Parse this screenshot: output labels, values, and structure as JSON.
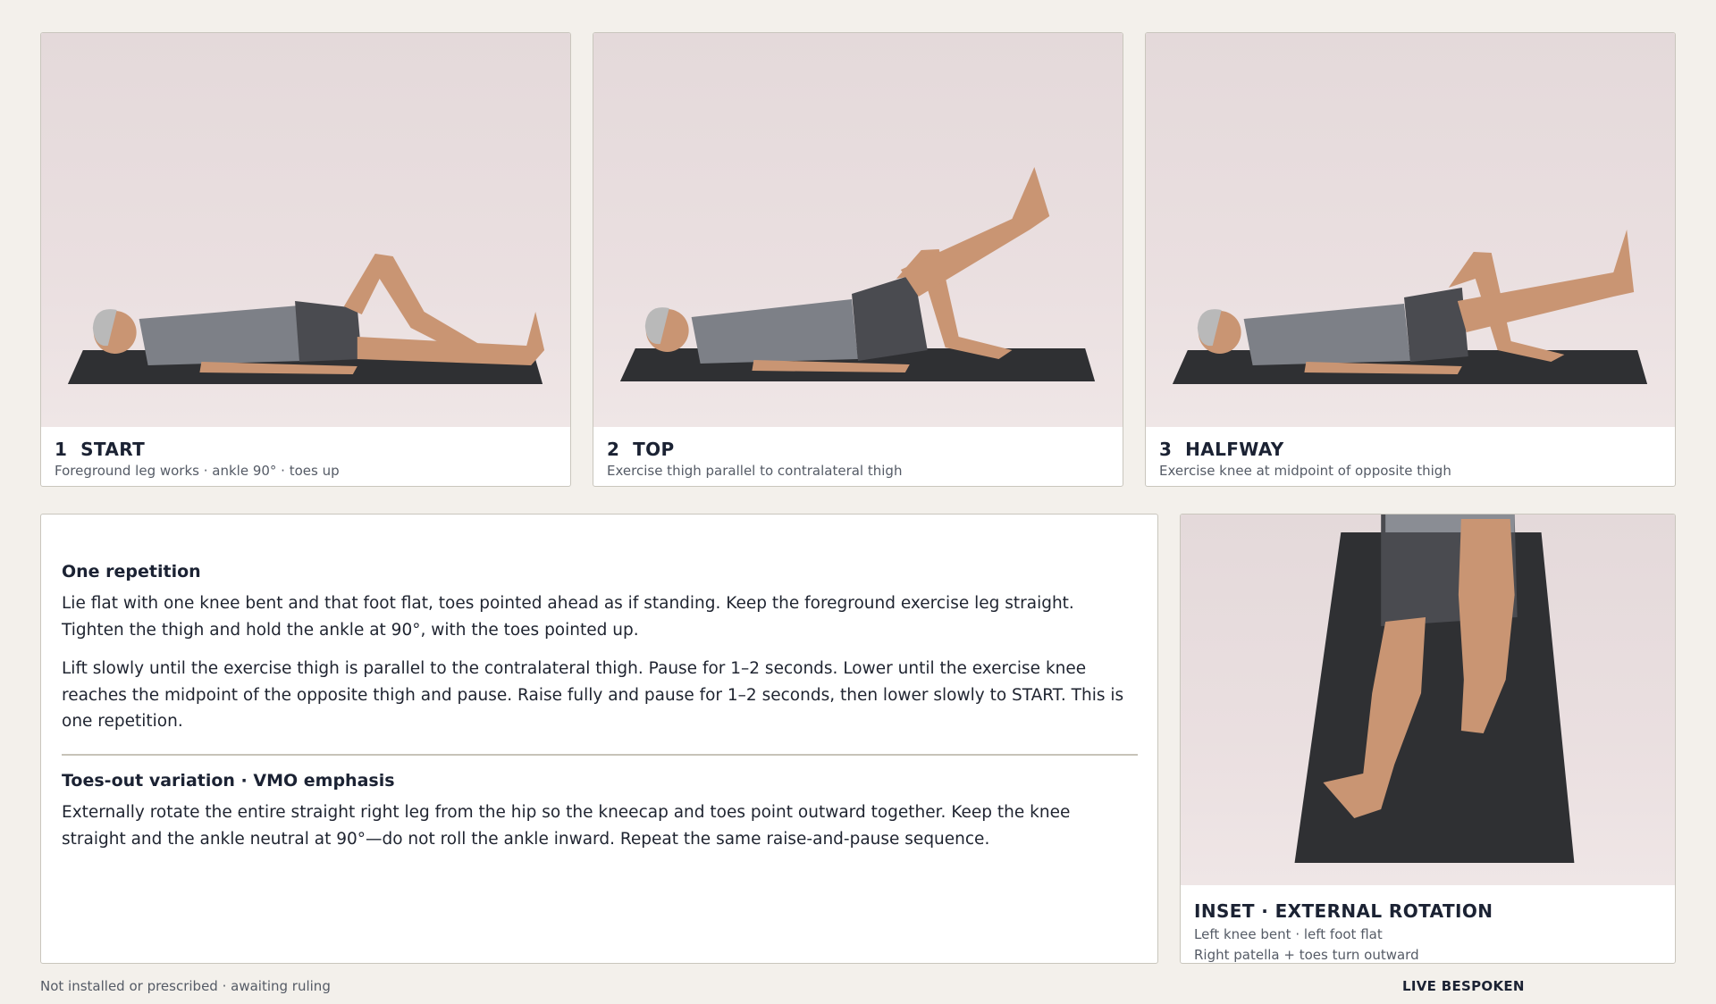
{
  "steps": [
    {
      "number": "1",
      "label": "START",
      "caption": "Foreground leg works · ankle 90° · toes up"
    },
    {
      "number": "2",
      "label": "TOP",
      "caption": "Exercise thigh parallel to contralateral thigh"
    },
    {
      "number": "3",
      "label": "HALFWAY",
      "caption": "Exercise knee at midpoint of opposite thigh"
    }
  ],
  "instructions": {
    "section1_title": "One repetition",
    "section1_p1": "Lie flat with one knee bent and that foot flat, toes pointed ahead as if standing. Keep the foreground exercise leg straight. Tighten the thigh and hold the ankle at 90°, with the toes pointed up.",
    "section1_p2": "Lift slowly until the exercise thigh is parallel to the contralateral thigh. Pause for 1–2 seconds. Lower until the exercise knee reaches the midpoint of the opposite thigh and pause. Raise fully and pause for 1–2 seconds, then lower slowly to START. This is one repetition.",
    "section2_title": "Toes-out variation · VMO emphasis",
    "section2_p1": "Externally rotate the entire straight right leg from the hip so the kneecap and toes point outward together. Keep the knee straight and the ankle neutral at 90°—do not roll the ankle inward. Repeat the same raise-and-pause sequence."
  },
  "inset": {
    "title": "INSET  ·  EXTERNAL ROTATION",
    "line1": "Left knee bent · left foot flat",
    "line2": "Right patella + toes turn outward"
  },
  "footer": {
    "left": "Not installed or prescribed · awaiting ruling",
    "right": "LIVE BESPOKEN"
  },
  "colors": {
    "background": "#f3f0eb",
    "mat": "#2f3033",
    "shirt": "#7d8087",
    "shorts": "#4a4b50",
    "skin": "#d09a72"
  }
}
